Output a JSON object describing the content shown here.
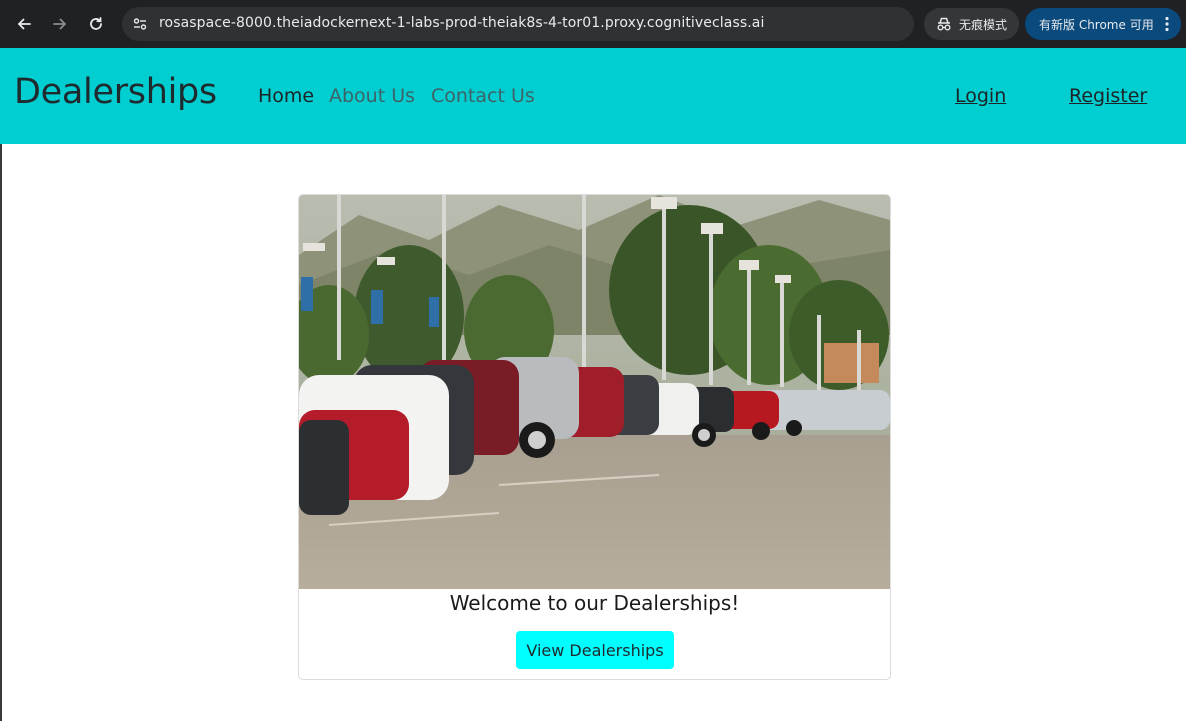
{
  "browser": {
    "url": "rosaspace-8000.theiadockernext-1-labs-prod-theiak8s-4-tor01.proxy.cognitiveclass.ai",
    "incognito_label": "无痕模式",
    "update_label": "有新版 Chrome 可用",
    "icons": [
      "back-icon",
      "forward-icon",
      "reload-icon",
      "site-settings-icon",
      "translate-icon",
      "star-icon",
      "incognito-icon",
      "menu-dots-icon"
    ]
  },
  "navbar": {
    "brand": "Dealerships",
    "links": [
      "Home",
      "About Us",
      "Contact Us"
    ],
    "login": "Login",
    "register": "Register",
    "bg_color": "#00ced1"
  },
  "card": {
    "image_description": "Parking lot filled with cars",
    "title": "Welcome to our Dealerships!",
    "button": "View Dealerships",
    "button_color": "#00ffff"
  }
}
